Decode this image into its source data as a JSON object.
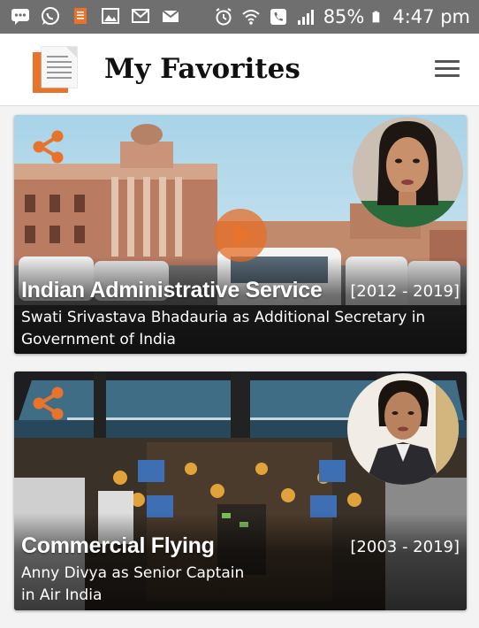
{
  "status_bar": {
    "icons": [
      "messages-icon",
      "whatsapp-icon",
      "document-icon",
      "image-icon",
      "gmail-icon",
      "mail-icon",
      "alarm-icon",
      "wifi-icon",
      "call-icon",
      "signal-icon",
      "battery-icon"
    ],
    "battery": "85%",
    "time": "4:47 pm"
  },
  "header": {
    "title": "My Favorites",
    "accent_color": "#e8732c",
    "menu_icon": "hamburger-menu-icon"
  },
  "favorites": [
    {
      "title": "Indian Administrative Service",
      "years": "[2012 - 2019]",
      "subtitle": "Swati Srivastava Bhadauria as Additional Secretary in Government of India",
      "share_icon": "share-icon",
      "play_icon": "play-icon"
    },
    {
      "title": "Commercial Flying",
      "years": "[2003 - 2019]",
      "subtitle": "Anny Divya as Senior Captain in Air India",
      "share_icon": "share-icon"
    }
  ]
}
